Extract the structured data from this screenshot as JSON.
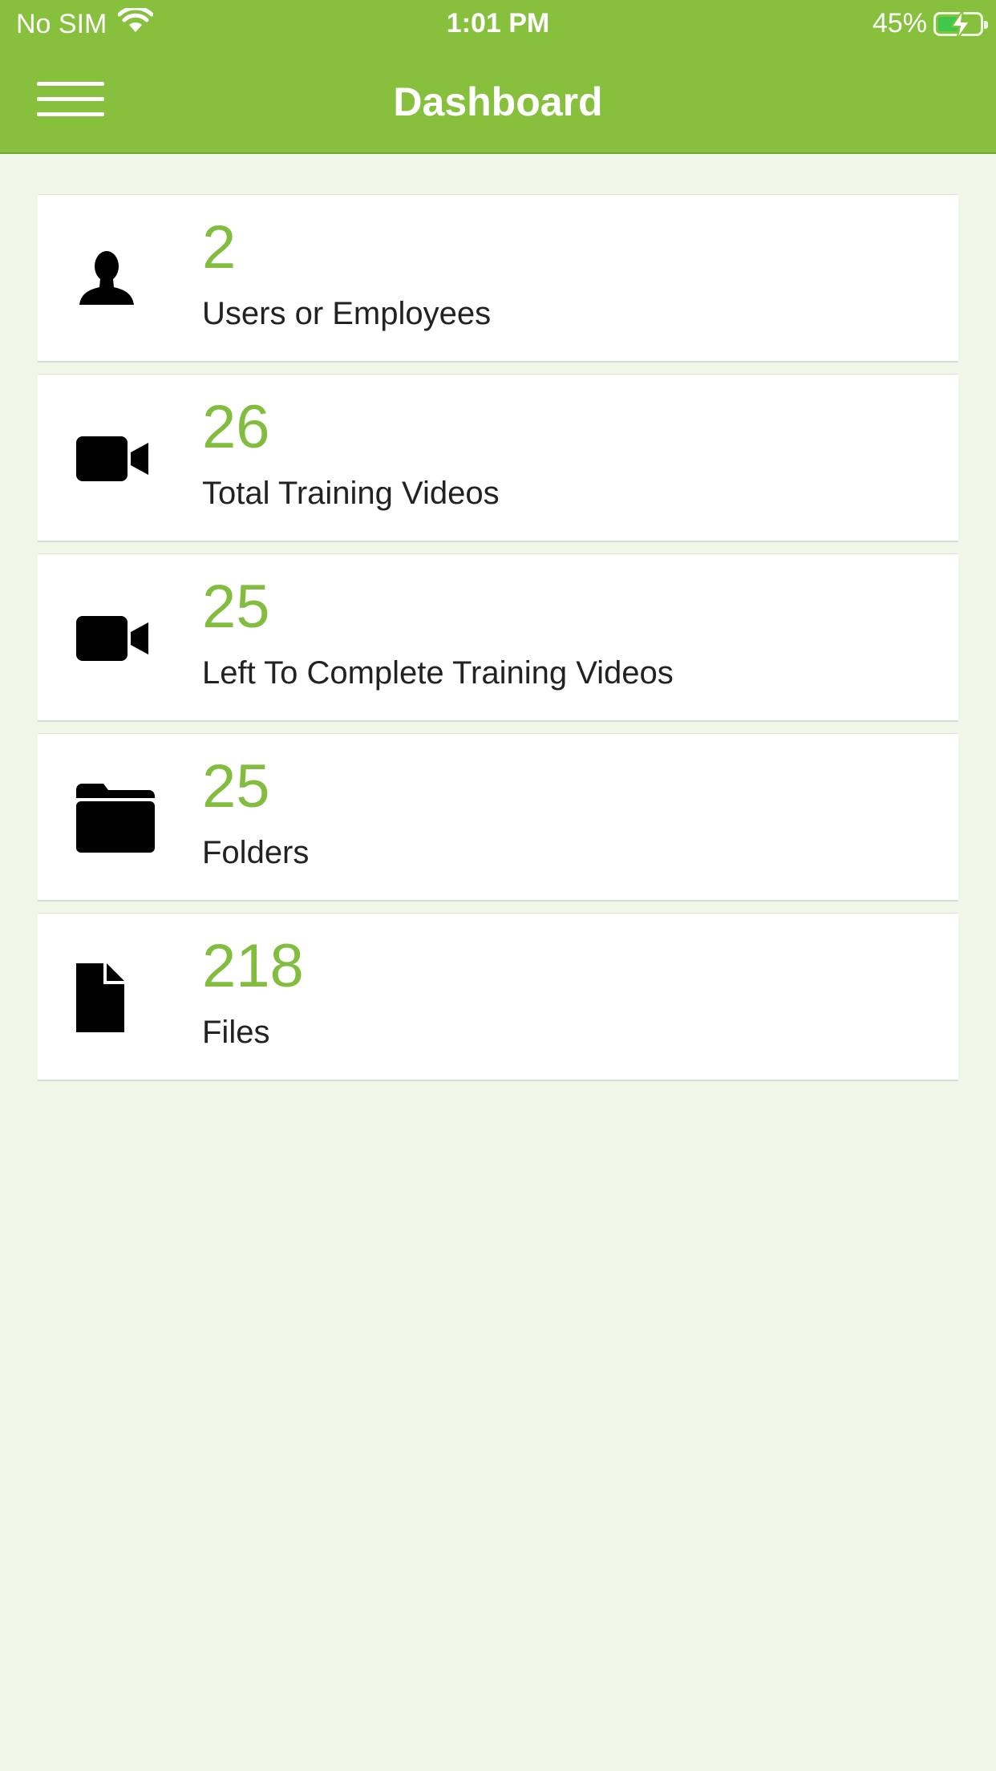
{
  "status_bar": {
    "carrier": "No SIM",
    "time": "1:01 PM",
    "battery_percent": "45%",
    "battery_level": 0.45
  },
  "header": {
    "title": "Dashboard",
    "menu_icon": "hamburger-menu-icon"
  },
  "colors": {
    "brand_green": "#87c03c",
    "count_green": "#82bd3f",
    "background": "#f0f6e8"
  },
  "cards": [
    {
      "count": "2",
      "label": "Users or Employees",
      "icon": "user-icon"
    },
    {
      "count": "26",
      "label": "Total Training Videos",
      "icon": "video-camera-icon"
    },
    {
      "count": "25",
      "label": "Left To Complete Training Videos",
      "icon": "video-camera-icon"
    },
    {
      "count": "25",
      "label": "Folders",
      "icon": "folder-icon"
    },
    {
      "count": "218",
      "label": "Files",
      "icon": "file-icon"
    }
  ]
}
